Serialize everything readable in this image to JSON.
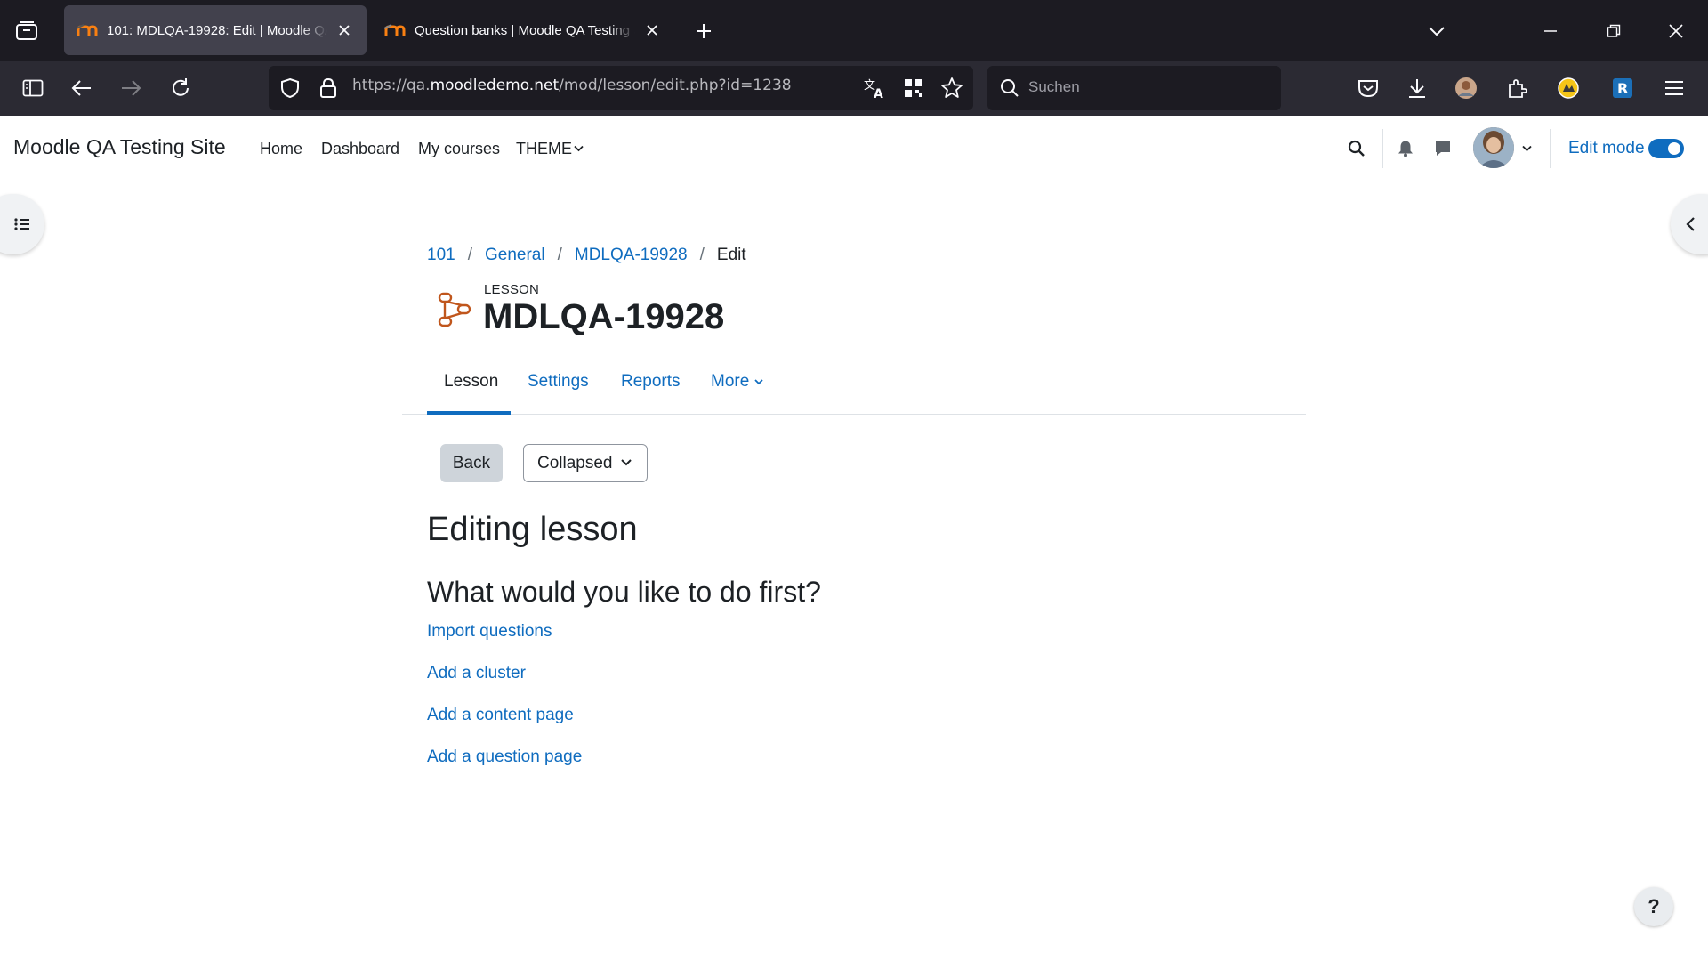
{
  "browser": {
    "tabs": [
      {
        "title": "101: MDLQA-19928: Edit | Moodle QA Testing Site",
        "active": true
      },
      {
        "title": "Question banks | Moodle QA Testing Site",
        "active": false
      }
    ],
    "url_prefix": "https://qa.",
    "url_host": "moodledemo.net",
    "url_path": "/mod/lesson/edit.php?id=1238",
    "search_placeholder": "Suchen"
  },
  "header": {
    "site_name": "Moodle QA Testing Site",
    "nav": [
      "Home",
      "Dashboard",
      "My courses",
      "THEME"
    ],
    "edit_mode_label": "Edit mode",
    "edit_mode_on": true
  },
  "breadcrumb": {
    "items": [
      "101",
      "General",
      "MDLQA-19928"
    ],
    "current": "Edit"
  },
  "activity": {
    "kind": "LESSON",
    "title": "MDLQA-19928"
  },
  "secondary_nav": {
    "tabs": [
      "Lesson",
      "Settings",
      "Reports",
      "More"
    ],
    "active": "Lesson"
  },
  "toolbar": {
    "back_label": "Back",
    "view_select_value": "Collapsed"
  },
  "main": {
    "heading": "Editing lesson",
    "subheading": "What would you like to do first?",
    "actions": [
      "Import questions",
      "Add a cluster",
      "Add a content page",
      "Add a question page"
    ]
  },
  "help": {
    "label": "?"
  },
  "colors": {
    "link": "#0f6cbf",
    "text": "#1d2125",
    "lesson_icon": "#c0561c",
    "chrome_dark": "#1c1b22"
  }
}
